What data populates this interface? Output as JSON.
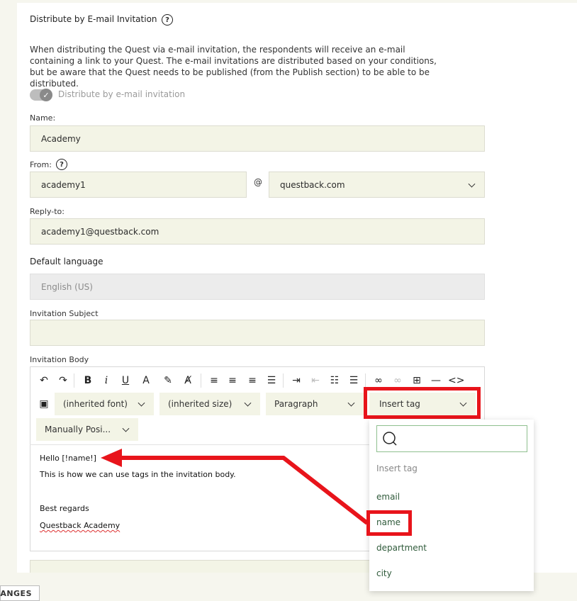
{
  "section": {
    "title": "Distribute by E-mail Invitation",
    "help_symbol": "?",
    "description": "When distributing the Quest via e-mail invitation, the respondents will receive an e-mail containing a link to your Quest. The e-mail invitations are distributed based on your conditions, but be aware that the Quest needs to be published (from the Publish section) to be able to be distributed.",
    "toggle_label": "Distribute by e-mail invitation",
    "toggle_checked": true
  },
  "form": {
    "name_label": "Name:",
    "name_value": "Academy",
    "from_label": "From:",
    "from_value": "academy1",
    "at_symbol": "@",
    "domain_value": "questback.com",
    "reply_label": "Reply-to:",
    "reply_value": "academy1@questback.com",
    "lang_label": "Default language",
    "lang_value": "English (US)",
    "subject_label": "Invitation Subject",
    "subject_value": "",
    "body_label": "Invitation Body"
  },
  "toolbar": {
    "font_select": "(inherited font)",
    "size_select": "(inherited size)",
    "block_select": "Paragraph",
    "tag_select": "Insert tag",
    "position_select": "Manually Posi..."
  },
  "body": {
    "line1": "Hello [!name!]",
    "line2": "This is how we can use tags in the invitation body.",
    "line3": "Best regards",
    "line4": "Questback Academy"
  },
  "dropdown": {
    "header": "Insert tag",
    "items": [
      "email",
      "name",
      "department",
      "city"
    ],
    "highlighted": "name"
  },
  "footer": {
    "button_label": "ANGES"
  },
  "colors": {
    "highlight": "#e8141b",
    "field_bg": "#f3f4e6",
    "tag_text": "#2f5a3a"
  }
}
